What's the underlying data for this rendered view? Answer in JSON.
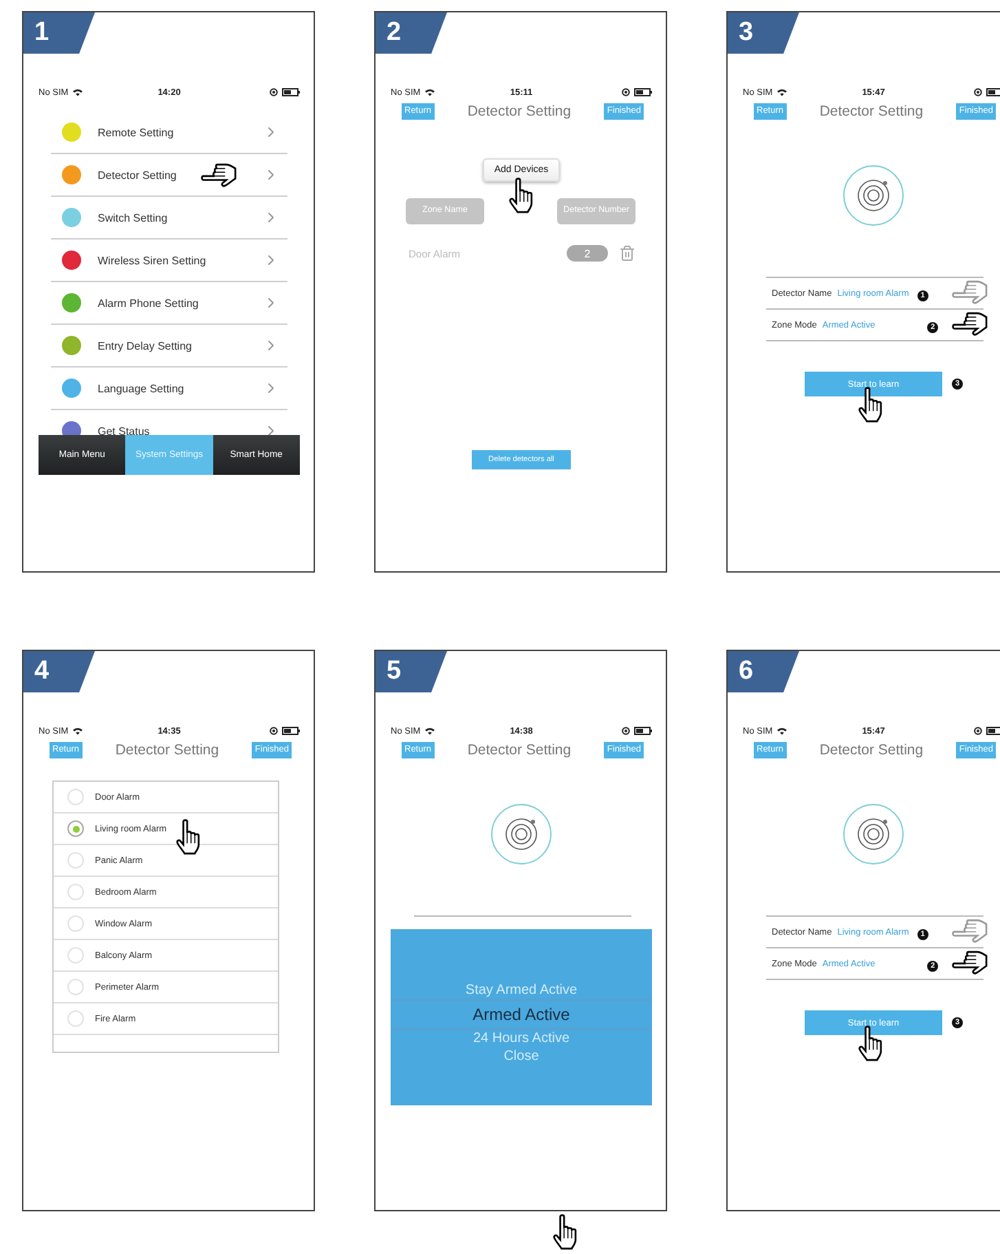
{
  "panels": [
    {
      "number": "1",
      "kind": "menu",
      "status": {
        "carrier": "No SIM",
        "time": "14:20"
      },
      "items": [
        {
          "label": "Remote Setting",
          "color": "#e2de1f",
          "pointed": false
        },
        {
          "label": "Detector Setting",
          "color": "#f39a1e",
          "pointed": true
        },
        {
          "label": "Switch Setting",
          "color": "#7ccfe0",
          "pointed": false
        },
        {
          "label": "Wireless Siren Setting",
          "color": "#e0293b",
          "pointed": false
        },
        {
          "label": "Alarm Phone Setting",
          "color": "#5cb533",
          "pointed": false
        },
        {
          "label": "Entry Delay Setting",
          "color": "#8fb52a",
          "pointed": false
        },
        {
          "label": "Language Setting",
          "color": "#4fb3e8",
          "pointed": false
        },
        {
          "label": "Get Status",
          "color": "#6a73c9",
          "pointed": false
        }
      ],
      "tabs": [
        {
          "label": "Main Menu",
          "selected": false
        },
        {
          "label": "System Settings",
          "selected": true
        },
        {
          "label": "Smart Home",
          "selected": false
        }
      ]
    },
    {
      "number": "2",
      "kind": "devices",
      "status": {
        "carrier": "No SIM",
        "time": "15:11"
      },
      "header": {
        "back": "Return",
        "title": "Detector Setting",
        "done": "Finished"
      },
      "add_button": "Add Devices",
      "columns": [
        "Zone Name",
        "Detector Number"
      ],
      "rows": [
        {
          "zone": "Door Alarm",
          "number": "2"
        }
      ],
      "delete_button": "Delete detectors all"
    },
    {
      "number": "3",
      "kind": "detail",
      "status": {
        "carrier": "No SIM",
        "time": "15:47"
      },
      "header": {
        "back": "Return",
        "title": "Detector Setting",
        "done": "Finished"
      },
      "fields": [
        {
          "label": "Detector Name",
          "value": "Living room Alarm",
          "marker": "1"
        },
        {
          "label": "Zone Mode",
          "value": "Armed Active",
          "marker": "2"
        }
      ],
      "learn_button": {
        "label": "Start to learn",
        "marker": "3"
      }
    },
    {
      "number": "4",
      "kind": "zones",
      "status": {
        "carrier": "No SIM",
        "time": "14:35"
      },
      "header": {
        "back": "Return",
        "title": "Detector Setting",
        "done": "Finished"
      },
      "options": [
        {
          "label": "Door Alarm",
          "selected": false
        },
        {
          "label": "Living room Alarm",
          "selected": true
        },
        {
          "label": "Panic Alarm",
          "selected": false
        },
        {
          "label": "Bedroom Alarm",
          "selected": false
        },
        {
          "label": "Window Alarm",
          "selected": false
        },
        {
          "label": "Balcony Alarm",
          "selected": false
        },
        {
          "label": "Perimeter Alarm",
          "selected": false
        },
        {
          "label": "Fire Alarm",
          "selected": false
        }
      ]
    },
    {
      "number": "5",
      "kind": "modes",
      "status": {
        "carrier": "No SIM",
        "time": "14:38"
      },
      "header": {
        "back": "Return",
        "title": "Detector Setting",
        "done": "Finished"
      },
      "options": [
        {
          "label": "Stay Armed Active",
          "selected": false
        },
        {
          "label": "Armed Active",
          "selected": true
        },
        {
          "label": "24 Hours Active",
          "selected": false
        },
        {
          "label": "Close",
          "selected": false
        }
      ]
    },
    {
      "number": "6",
      "kind": "detail",
      "status": {
        "carrier": "No SIM",
        "time": "15:47"
      },
      "header": {
        "back": "Return",
        "title": "Detector Setting",
        "done": "Finished"
      },
      "fields": [
        {
          "label": "Detector Name",
          "value": "Living room Alarm",
          "marker": "1"
        },
        {
          "label": "Zone Mode",
          "value": "Armed Active",
          "marker": "2"
        }
      ],
      "learn_button": {
        "label": "Start to learn",
        "marker": "3"
      }
    }
  ]
}
